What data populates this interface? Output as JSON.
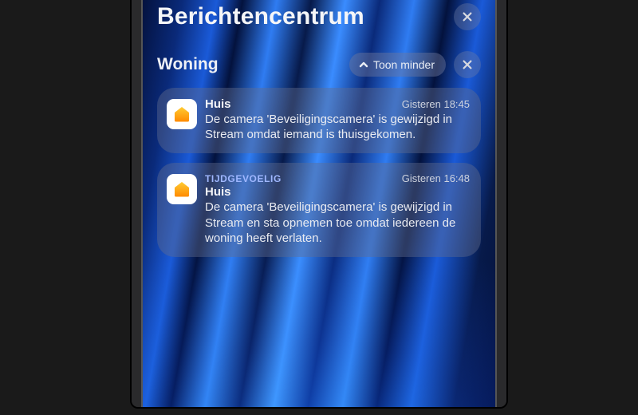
{
  "header": {
    "title": "Berichtencentrum"
  },
  "group": {
    "title": "Woning",
    "show_less_label": "Toon minder"
  },
  "notifications": [
    {
      "app": "Huis",
      "time": "Gisteren 18:45",
      "eyebrow": "",
      "body": "De camera 'Beveiligingscamera' is gewijzigd in Stream omdat iemand is thuisgekomen."
    },
    {
      "app": "Huis",
      "time": "Gisteren 16:48",
      "eyebrow": "TIJDGEVOELIG",
      "body": "De camera 'Beveiligingscamera' is gewijzigd in Stream en sta opnemen toe omdat iedereen de woning heeft verlaten."
    }
  ],
  "icons": {
    "app_icon_name": "home-icon"
  }
}
